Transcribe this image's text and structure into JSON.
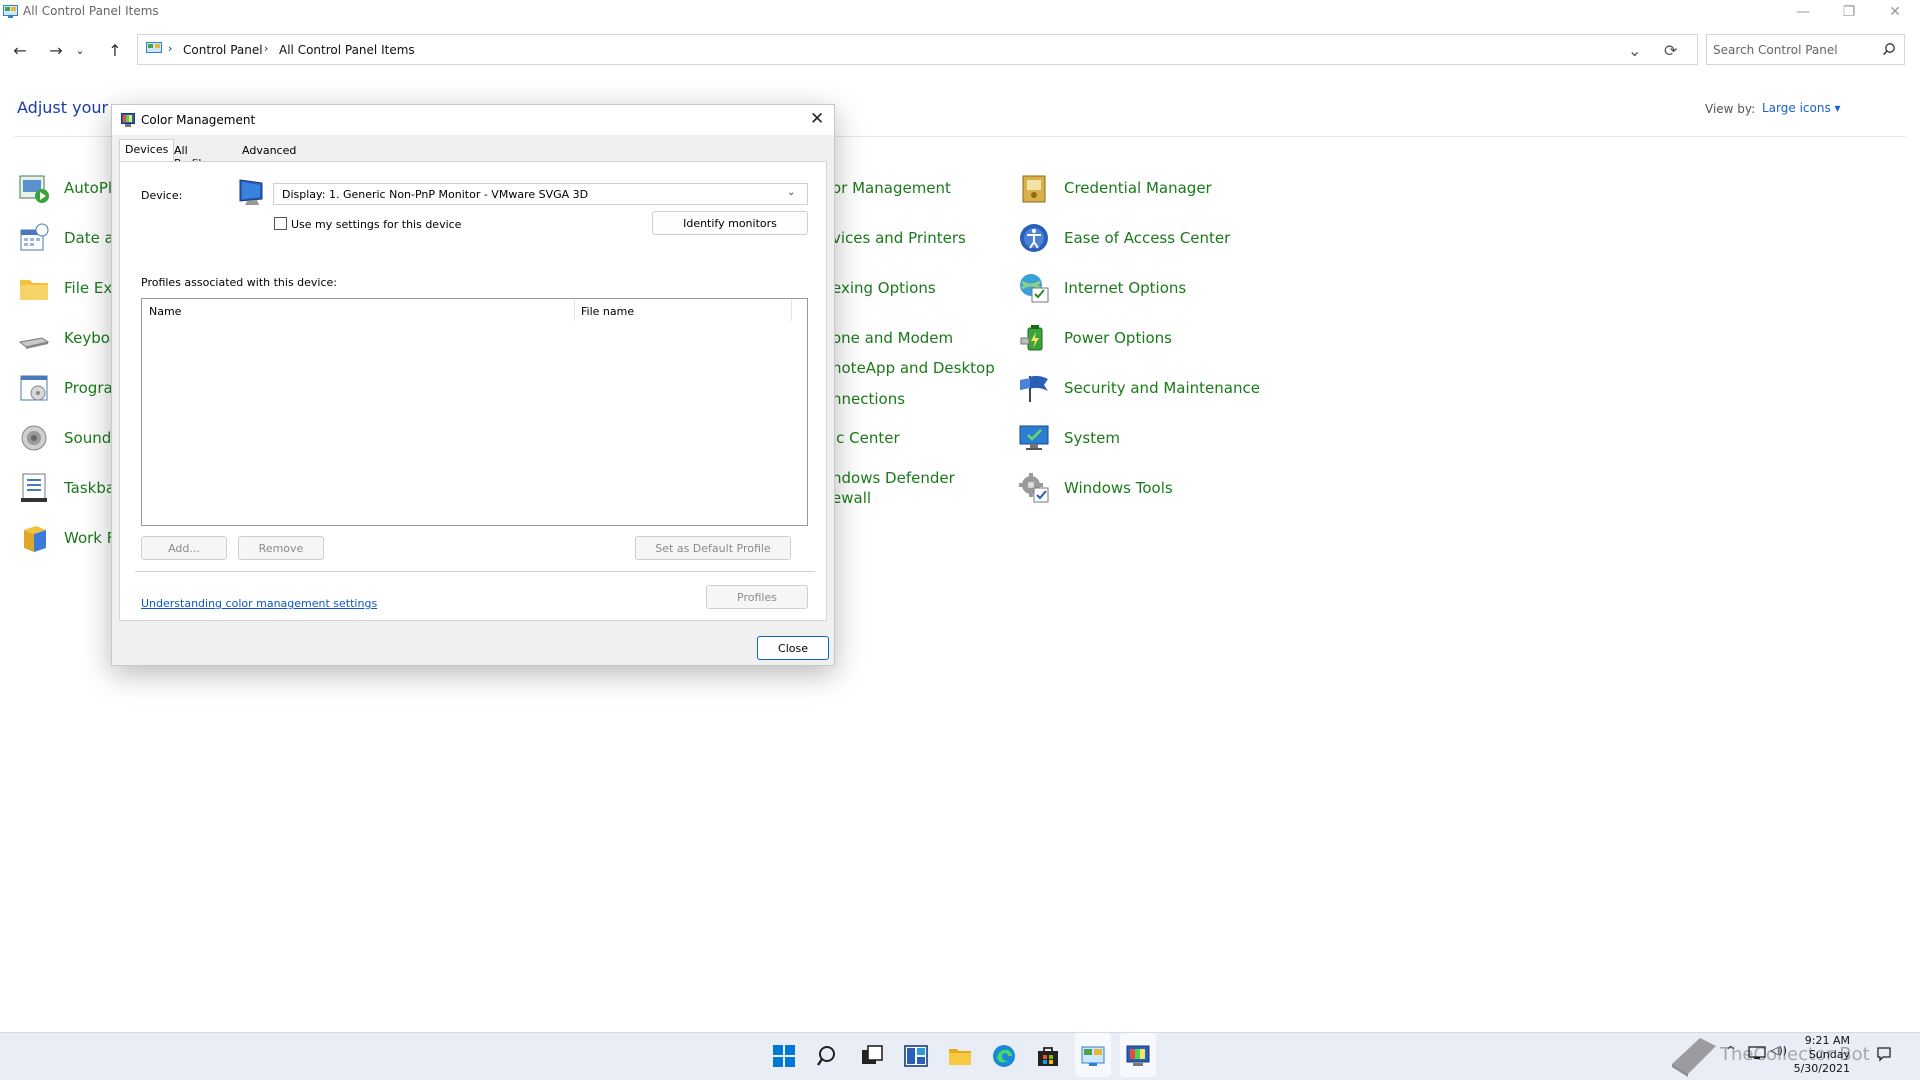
{
  "window": {
    "title": "All Control Panel Items",
    "minimize_glyph": "—",
    "maximize_glyph": "❐",
    "close_glyph": "✕"
  },
  "nav": {
    "back_glyph": "←",
    "forward_glyph": "→",
    "recent_glyph": "⌄",
    "up_glyph": "↑",
    "breadcrumb": [
      "Control Panel",
      "All Control Panel Items"
    ],
    "crumb_separator": "›",
    "dropdown_glyph": "⌄",
    "refresh_glyph": "⟳",
    "search_placeholder": "Search Control Panel"
  },
  "page": {
    "heading": "Adjust your co",
    "view_by_label": "View by:",
    "view_by_value": "Large icons ▾"
  },
  "items": {
    "col1": [
      "AutoPla",
      "Date ar",
      "File Exp",
      "Keyboa",
      "Prograi",
      "Sound",
      "Taskbar",
      "Work F"
    ],
    "col3": [
      "or Management",
      "vices and Printers",
      "exing Options",
      "one and Modem",
      "noteApp and Desktop",
      "nnections",
      "ıc Center",
      "ndows Defender",
      "ewall"
    ],
    "col4": [
      "Credential Manager",
      "Ease of Access Center",
      "Internet Options",
      "Power Options",
      "Security and Maintenance",
      "System",
      "Windows Tools"
    ]
  },
  "dialog": {
    "title": "Color Management",
    "close_glyph": "✕",
    "tabs": [
      "Devices",
      "All Profiles",
      "Advanced"
    ],
    "device_label": "Device:",
    "device_value": "Display: 1. Generic Non-PnP Monitor - VMware SVGA 3D",
    "select_caret": "⌄",
    "use_settings_label": "Use my settings for this device",
    "use_settings_checked": false,
    "identify_button": "Identify monitors",
    "profiles_label": "Profiles associated with this device:",
    "columns": [
      "Name",
      "File name"
    ],
    "add_button": "Add...",
    "remove_button": "Remove",
    "default_button": "Set as Default Profile",
    "profiles_button": "Profiles",
    "help_link": "Understanding color management settings",
    "close_button": "Close"
  },
  "taskbar": {
    "tray_chevron": "^",
    "volume_glyph": "◁))",
    "time": "9:21 AM",
    "day": "Sunday",
    "date": "5/30/2021",
    "watermark": "TheCollector Bot",
    "accent_color": "#0078d4"
  }
}
